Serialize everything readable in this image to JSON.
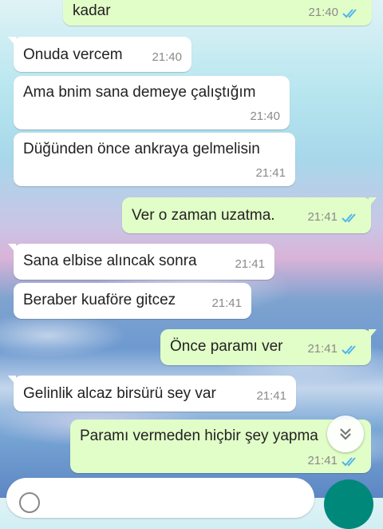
{
  "colors": {
    "incoming": "#ffffff",
    "outgoing": "#e2fec8",
    "tick_read": "#4fb6ec",
    "send_button": "#00897b"
  },
  "messages": [
    {
      "dir": "out",
      "text": "kadar",
      "time": "21:40",
      "ticks": "double-check-icon"
    },
    {
      "dir": "in",
      "text": "Onuda vercem",
      "time": "21:40"
    },
    {
      "dir": "in",
      "text": "Ama bnim sana demeye çalıştığım",
      "time": "21:40"
    },
    {
      "dir": "in",
      "text": "Düğünden önce ankraya gelmelisin",
      "time": "21:41"
    },
    {
      "dir": "out",
      "text": "Ver o zaman uzatma.",
      "time": "21:41",
      "ticks": "double-check-icon"
    },
    {
      "dir": "in",
      "text": "Sana elbise alıncak sonra",
      "time": "21:41"
    },
    {
      "dir": "in",
      "text": "Beraber kuaföre gitcez",
      "time": "21:41"
    },
    {
      "dir": "out",
      "text": "Önce paramı ver",
      "time": "21:41",
      "ticks": "double-check-icon"
    },
    {
      "dir": "in",
      "text": "Gelinlik alcaz birsürü sey var",
      "time": "21:41"
    },
    {
      "dir": "out",
      "text": "Paramı vermeden hiçbir şey yapma",
      "time": "21:41",
      "ticks": "double-check-icon"
    }
  ],
  "icons": {
    "scroll_down": "double-chevron-down-icon",
    "emoji": "emoji-icon",
    "mic": "mic-icon"
  }
}
